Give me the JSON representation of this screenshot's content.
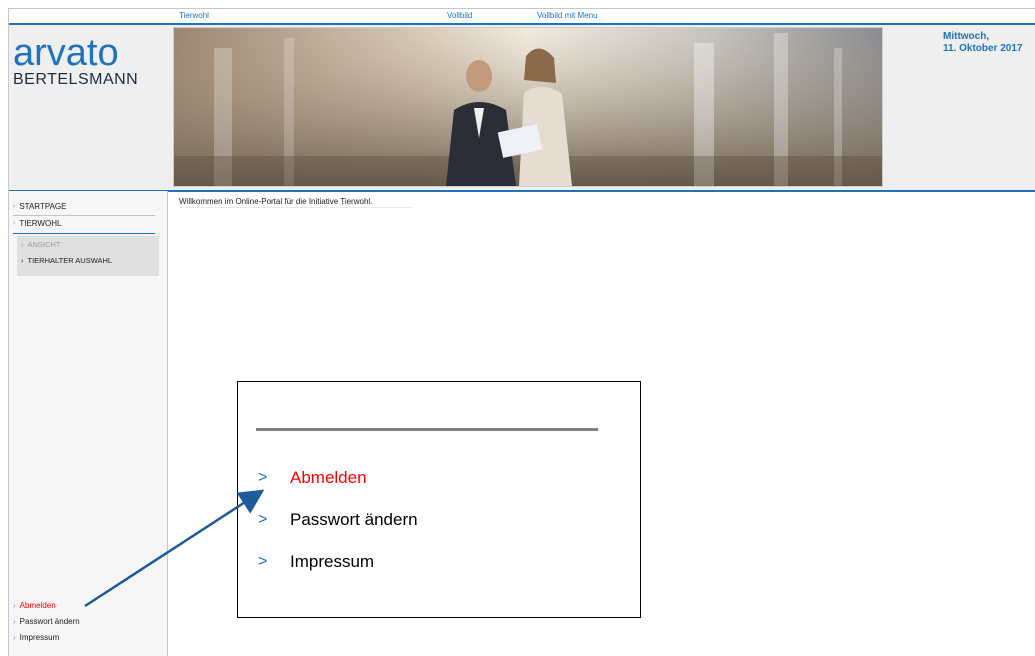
{
  "topbar": {
    "links": [
      "Tierwohl",
      "Vollbild",
      "Vollbild mit Menu"
    ]
  },
  "header": {
    "logo_main": "arvato",
    "logo_sub": "BERTELSMANN",
    "date_line1": "Mittwoch,",
    "date_line2": "11. Oktober 2017"
  },
  "nav": {
    "items": [
      "STARTPAGE",
      "TIERWOHL"
    ],
    "sub_items": [
      "ANSICHT",
      "TIERHALTER AUSWAHL"
    ]
  },
  "bottom_links": [
    "Abmelden",
    "Passwort ändern",
    "Impressum"
  ],
  "content": {
    "welcome": "Willkommen im Online-Portal für die Initiative Tierwohl."
  },
  "zoom": {
    "items": [
      "Abmelden",
      "Passwort ändern",
      "Impressum"
    ]
  },
  "colors": {
    "accent": "#1e73be",
    "active_link": "#ff0000"
  }
}
